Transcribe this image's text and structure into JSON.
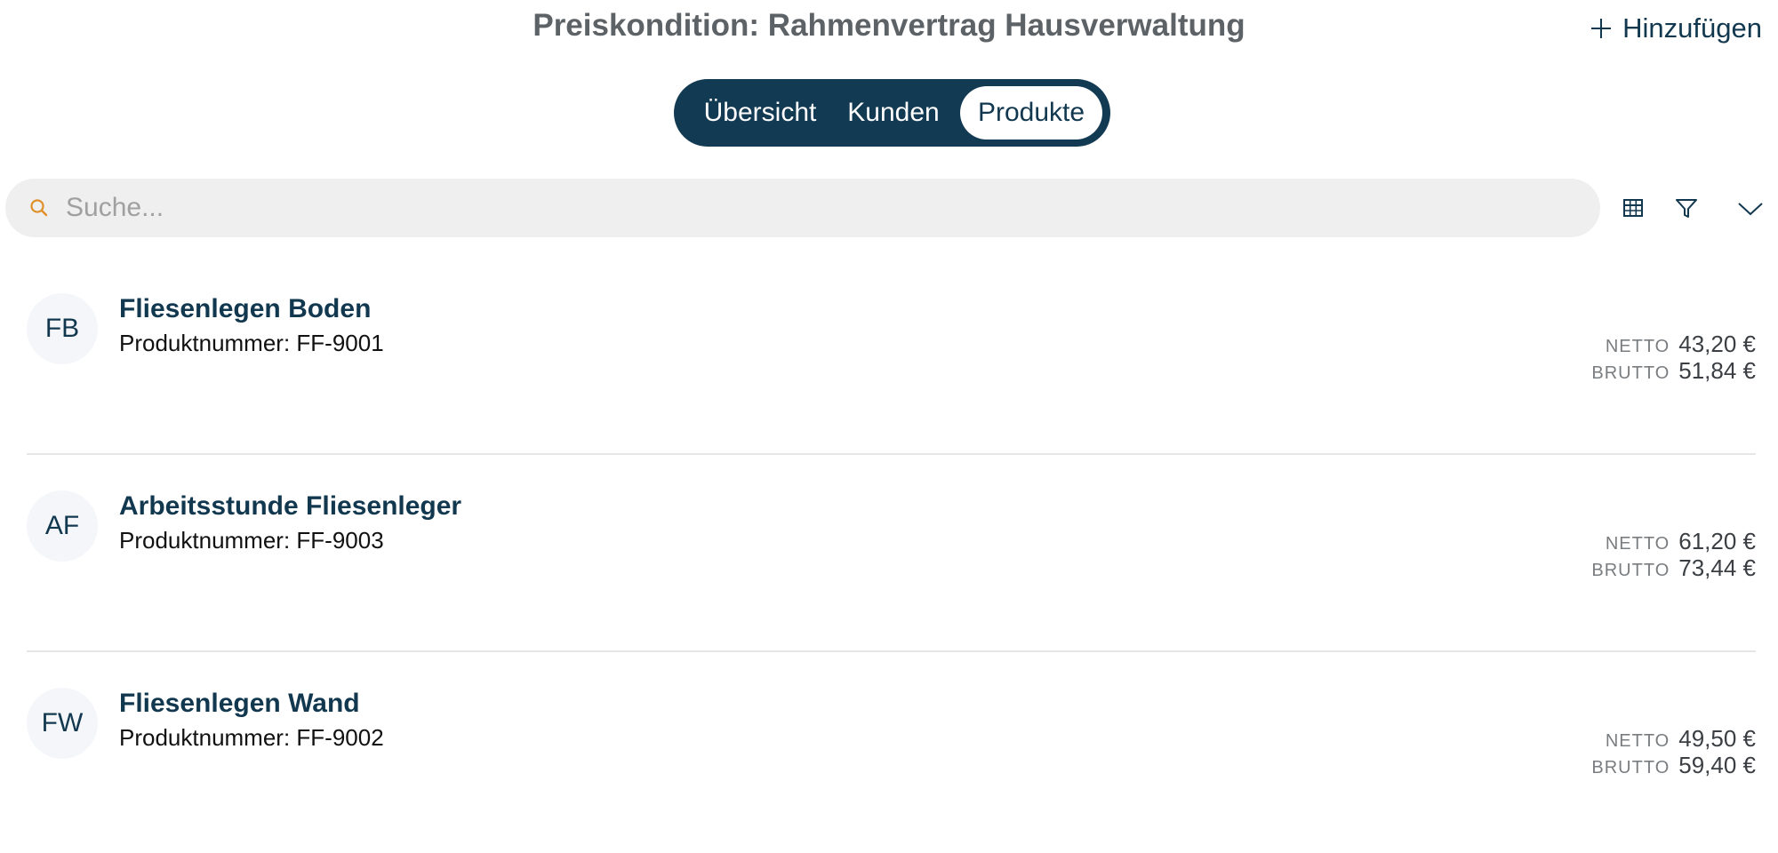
{
  "header": {
    "title": "Preiskondition: Rahmenvertrag Hausverwaltung",
    "add_label": "Hinzufügen"
  },
  "tabs": [
    {
      "label": "Übersicht",
      "active": false
    },
    {
      "label": "Kunden",
      "active": false
    },
    {
      "label": "Produkte",
      "active": true
    }
  ],
  "search": {
    "placeholder": "Suche...",
    "value": ""
  },
  "toolbar": {
    "icons": [
      "table-icon",
      "filter-icon",
      "chevron-down-icon"
    ]
  },
  "products": [
    {
      "initials": "FB",
      "name": "Fliesenlegen Boden",
      "sku": "Produktnummer: FF-9001",
      "net_label": "NETTO",
      "net": "43,20 €",
      "gross_label": "BRUTTO",
      "gross": "51,84 €"
    },
    {
      "initials": "AF",
      "name": "Arbeitsstunde Fliesenleger",
      "sku": "Produktnummer: FF-9003",
      "net_label": "NETTO",
      "net": "61,20 €",
      "gross_label": "BRUTTO",
      "gross": "73,44 €"
    },
    {
      "initials": "FW",
      "name": "Fliesenlegen Wand",
      "sku": "Produktnummer: FF-9002",
      "net_label": "NETTO",
      "net": "49,50 €",
      "gross_label": "BRUTTO",
      "gross": "59,40 €"
    }
  ],
  "colors": {
    "primary": "#133a53",
    "title_gray": "#5d6266",
    "search_bg": "#efefef",
    "search_icon": "#e0902a",
    "avatar_bg": "#f4f6f9"
  }
}
